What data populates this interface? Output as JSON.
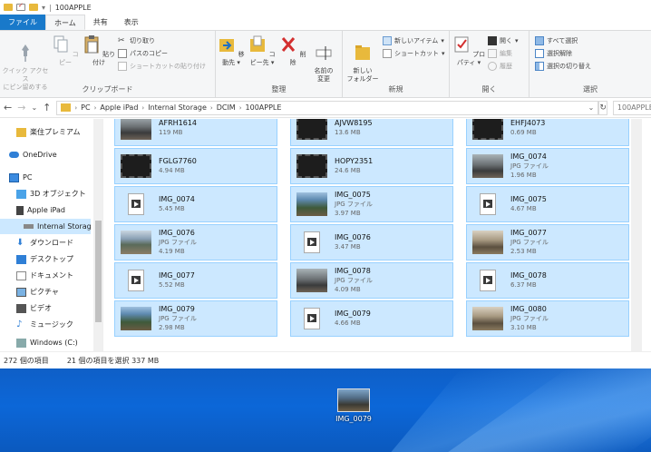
{
  "window": {
    "title": "100APPLE"
  },
  "tabs": [
    {
      "label": "ファイル"
    },
    {
      "label": "ホーム"
    },
    {
      "label": "共有"
    },
    {
      "label": "表示"
    }
  ],
  "ribbon": {
    "clipboard": {
      "label": "クリップボード",
      "pin": "クイック アクセス\nにピン留めする",
      "copy": "コピー",
      "paste": "貼り付け",
      "cut": "切り取り",
      "copy_path": "パスのコピー",
      "paste_shortcut": "ショートカットの貼り付け"
    },
    "organize": {
      "label": "整理",
      "move_to": "移動先",
      "copy_to": "コピー先",
      "delete": "削除",
      "rename": "名前の\n変更"
    },
    "new": {
      "label": "新規",
      "new_folder": "新しい\nフォルダー",
      "new_item": "新しいアイテム",
      "shortcut": "ショートカット"
    },
    "open": {
      "label": "開く",
      "properties": "プロパティ",
      "open": "開く",
      "edit": "編集",
      "history": "履歴"
    },
    "select": {
      "label": "選択",
      "select_all": "すべて選択",
      "select_none": "選択解除",
      "invert": "選択の切り替え"
    }
  },
  "address": {
    "crumbs": [
      "PC",
      "Apple iPad",
      "Internal Storage",
      "DCIM",
      "100APPLE"
    ],
    "search_placeholder": "100APPLE"
  },
  "nav": {
    "items": [
      {
        "label": "楽住プレミアム",
        "icon": "folder-icon"
      },
      {
        "label": "OneDrive",
        "icon": "cloud-icon"
      },
      {
        "label": "PC",
        "icon": "pc-icon"
      },
      {
        "label": "3D オブジェクト",
        "icon": "cube-icon"
      },
      {
        "label": "Apple iPad",
        "icon": "ipad-icon"
      },
      {
        "label": "Internal Storag",
        "icon": "drive-icon"
      },
      {
        "label": "ダウンロード",
        "icon": "download-icon"
      },
      {
        "label": "デスクトップ",
        "icon": "desktop-icon"
      },
      {
        "label": "ドキュメント",
        "icon": "document-icon"
      },
      {
        "label": "ピクチャ",
        "icon": "picture-icon"
      },
      {
        "label": "ビデオ",
        "icon": "video-icon"
      },
      {
        "label": "ミュージック",
        "icon": "music-icon"
      },
      {
        "label": "Windows (C:)",
        "icon": "windows-drive-icon"
      }
    ]
  },
  "files": [
    {
      "name": "AFRH1614",
      "sub": "119 MB",
      "thumb": "photo-c"
    },
    {
      "name": "AJVW8195",
      "sub": "13.6 MB",
      "thumb": "film"
    },
    {
      "name": "EHFJ4073",
      "sub": "0.69 MB",
      "thumb": "film"
    },
    {
      "name": "FGLG7760",
      "sub": "4.94 MB",
      "thumb": "film"
    },
    {
      "name": "HOPY2351",
      "sub": "24.6 MB",
      "thumb": "film"
    },
    {
      "name": "IMG_0074",
      "sub": "JPG ファイル",
      "sub2": "1.96 MB",
      "thumb": "photo-c"
    },
    {
      "name": "IMG_0074",
      "sub": "5.45 MB",
      "thumb": "video"
    },
    {
      "name": "IMG_0075",
      "sub": "JPG ファイル",
      "sub2": "3.97 MB",
      "thumb": "photo-b"
    },
    {
      "name": "IMG_0075",
      "sub": "4.67 MB",
      "thumb": "video"
    },
    {
      "name": "IMG_0076",
      "sub": "JPG ファイル",
      "sub2": "4.19 MB",
      "thumb": "photo-a"
    },
    {
      "name": "IMG_0076",
      "sub": "3.47 MB",
      "thumb": "video"
    },
    {
      "name": "IMG_0077",
      "sub": "JPG ファイル",
      "sub2": "2.53 MB",
      "thumb": "photo-d"
    },
    {
      "name": "IMG_0077",
      "sub": "5.52 MB",
      "thumb": "video"
    },
    {
      "name": "IMG_0078",
      "sub": "JPG ファイル",
      "sub2": "4.09 MB",
      "thumb": "photo-c"
    },
    {
      "name": "IMG_0078",
      "sub": "6.37 MB",
      "thumb": "video"
    },
    {
      "name": "IMG_0079",
      "sub": "JPG ファイル",
      "sub2": "2.98 MB",
      "thumb": "photo-b"
    },
    {
      "name": "IMG_0079",
      "sub": "4.66 MB",
      "thumb": "video"
    },
    {
      "name": "IMG_0080",
      "sub": "JPG ファイル",
      "sub2": "3.10 MB",
      "thumb": "photo-d"
    }
  ],
  "status": {
    "count": "272 個の項目",
    "selected": "21 個の項目を選択 337 MB"
  },
  "desktop": {
    "icon_label": "IMG_0079"
  }
}
